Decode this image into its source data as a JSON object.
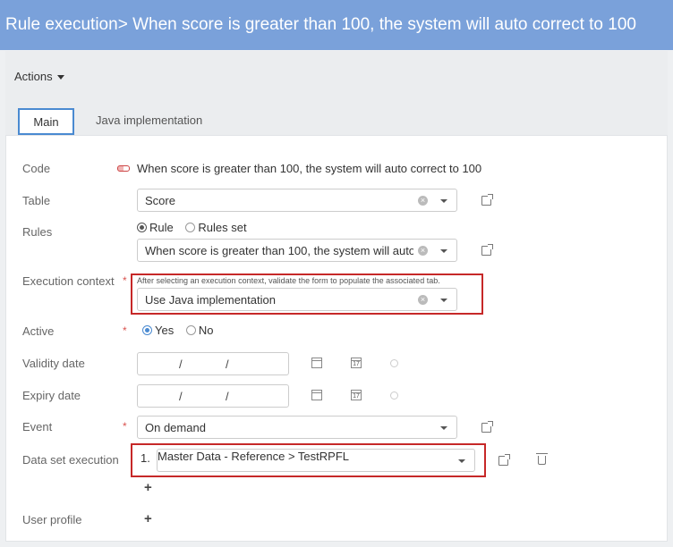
{
  "header": {
    "title": "Rule execution> When score is greater than 100, the system will auto correct to 100"
  },
  "toolbar": {
    "actions_label": "Actions"
  },
  "tabs": [
    {
      "label": "Main",
      "active": true
    },
    {
      "label": "Java implementation",
      "active": false
    }
  ],
  "form": {
    "code": {
      "label": "Code",
      "value": "When score is greater than 100, the system will auto correct to 100"
    },
    "table": {
      "label": "Table",
      "value": "Score"
    },
    "rules": {
      "label": "Rules",
      "options": [
        "Rule",
        "Rules set"
      ],
      "selected": "Rule",
      "value": "When score is greater than 100, the system will auto c"
    },
    "execution_context": {
      "label": "Execution context",
      "required_mark": "*",
      "hint": "After selecting an execution context, validate the form to populate the associated tab.",
      "value": "Use Java implementation"
    },
    "active": {
      "label": "Active",
      "required_mark": "*",
      "options": [
        "Yes",
        "No"
      ],
      "selected": "Yes"
    },
    "validity_date": {
      "label": "Validity date",
      "separator": "/"
    },
    "expiry_date": {
      "label": "Expiry date",
      "separator": "/"
    },
    "event": {
      "label": "Event",
      "required_mark": "*",
      "value": "On demand"
    },
    "data_set_execution": {
      "label": "Data set execution",
      "items": [
        {
          "index": "1.",
          "value": "Master Data - Reference > TestRPFL"
        }
      ],
      "add_label": "+"
    },
    "user_profile": {
      "label": "User profile",
      "add_label": "+"
    }
  },
  "icons": {
    "clear": "×",
    "calendar_day": "17"
  },
  "colors": {
    "header_bg": "#7aa1da",
    "highlight_box": "#c62828",
    "accent": "#4a8ad1"
  }
}
